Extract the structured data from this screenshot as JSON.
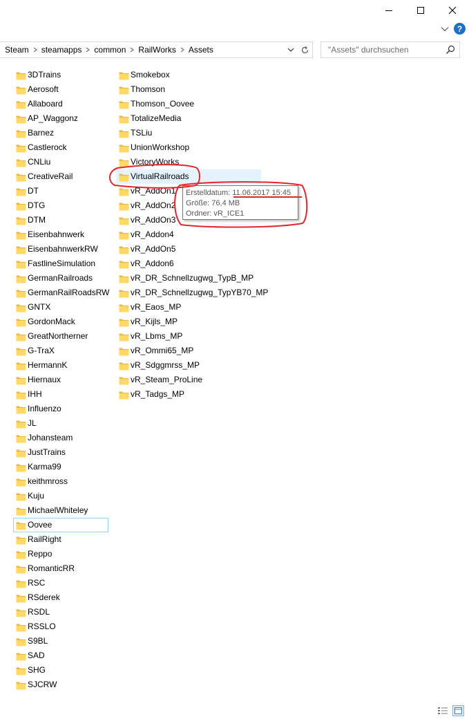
{
  "window": {
    "controls": {
      "minimize": "minimize-icon",
      "maximize": "maximize-icon",
      "close": "close-icon"
    },
    "help_symbol": "?"
  },
  "address": {
    "breadcrumbs": [
      "Steam",
      "steamapps",
      "common",
      "RailWorks",
      "Assets"
    ]
  },
  "search": {
    "placeholder": "\"Assets\" durchsuchen",
    "value": ""
  },
  "folders": {
    "column1": [
      "3DTrains",
      "Aerosoft",
      "Allaboard",
      "AP_Waggonz",
      "Barnez",
      "Castlerock",
      "CNLiu",
      "CreativeRail",
      "DT",
      "DTG",
      "DTM",
      "Eisenbahnwerk",
      "EisenbahnwerkRW",
      "FastlineSimulation",
      "GermanRailroads",
      "GermanRailRoadsRW",
      "GNTX",
      "GordonMack",
      "GreatNortherner",
      "G-TraX",
      "HermannK",
      "Hiernaux",
      "IHH",
      "Influenzo",
      "JL",
      "Johansteam",
      "JustTrains",
      "Karma99",
      "keithmross",
      "Kuju",
      "MichaelWhiteley",
      "Oovee",
      "RailRight",
      "Reppo",
      "RomanticRR",
      "RSC",
      "RSderek",
      "RSDL",
      "RSSLO",
      "S9BL",
      "SAD",
      "SHG",
      "SJCRW"
    ],
    "column2": [
      "Smokebox",
      "Thomson",
      "Thomson_Oovee",
      "TotalizeMedia",
      "TSLiu",
      "UnionWorkshop",
      "VictoryWorks",
      "VirtualRailroads",
      "vR_AddOn1",
      "vR_AddOn2",
      "vR_AddOn3",
      "vR_Addon4",
      "vR_AddOn5",
      "vR_Addon6",
      "vR_DR_Schnellzugwg_TypB_MP",
      "vR_DR_Schnellzugwg_TypYB70_MP",
      "vR_Eaos_MP",
      "vR_Kijls_MP",
      "vR_Lbms_MP",
      "vR_Ommi65_MP",
      "vR_Sdggmrss_MP",
      "vR_Steam_ProLine",
      "vR_Tadgs_MP"
    ],
    "focused": "Oovee",
    "hovered": "VirtualRailroads"
  },
  "tooltip": {
    "created": "Erstelldatum: 11.06.2017 15:45",
    "size": "Größe: 76,4 MB",
    "folders": "Ordner: vR_ICE1"
  },
  "colors": {
    "folder": "#ffd866",
    "folder_tab": "#e8b84a",
    "hover": "#e5f3ff",
    "focus_outline": "#99d1ff",
    "annotation": "#e3242b",
    "help": "#1f6fc4"
  },
  "statusbar": {
    "views": [
      "details-view-icon",
      "large-icons-view-icon"
    ]
  }
}
